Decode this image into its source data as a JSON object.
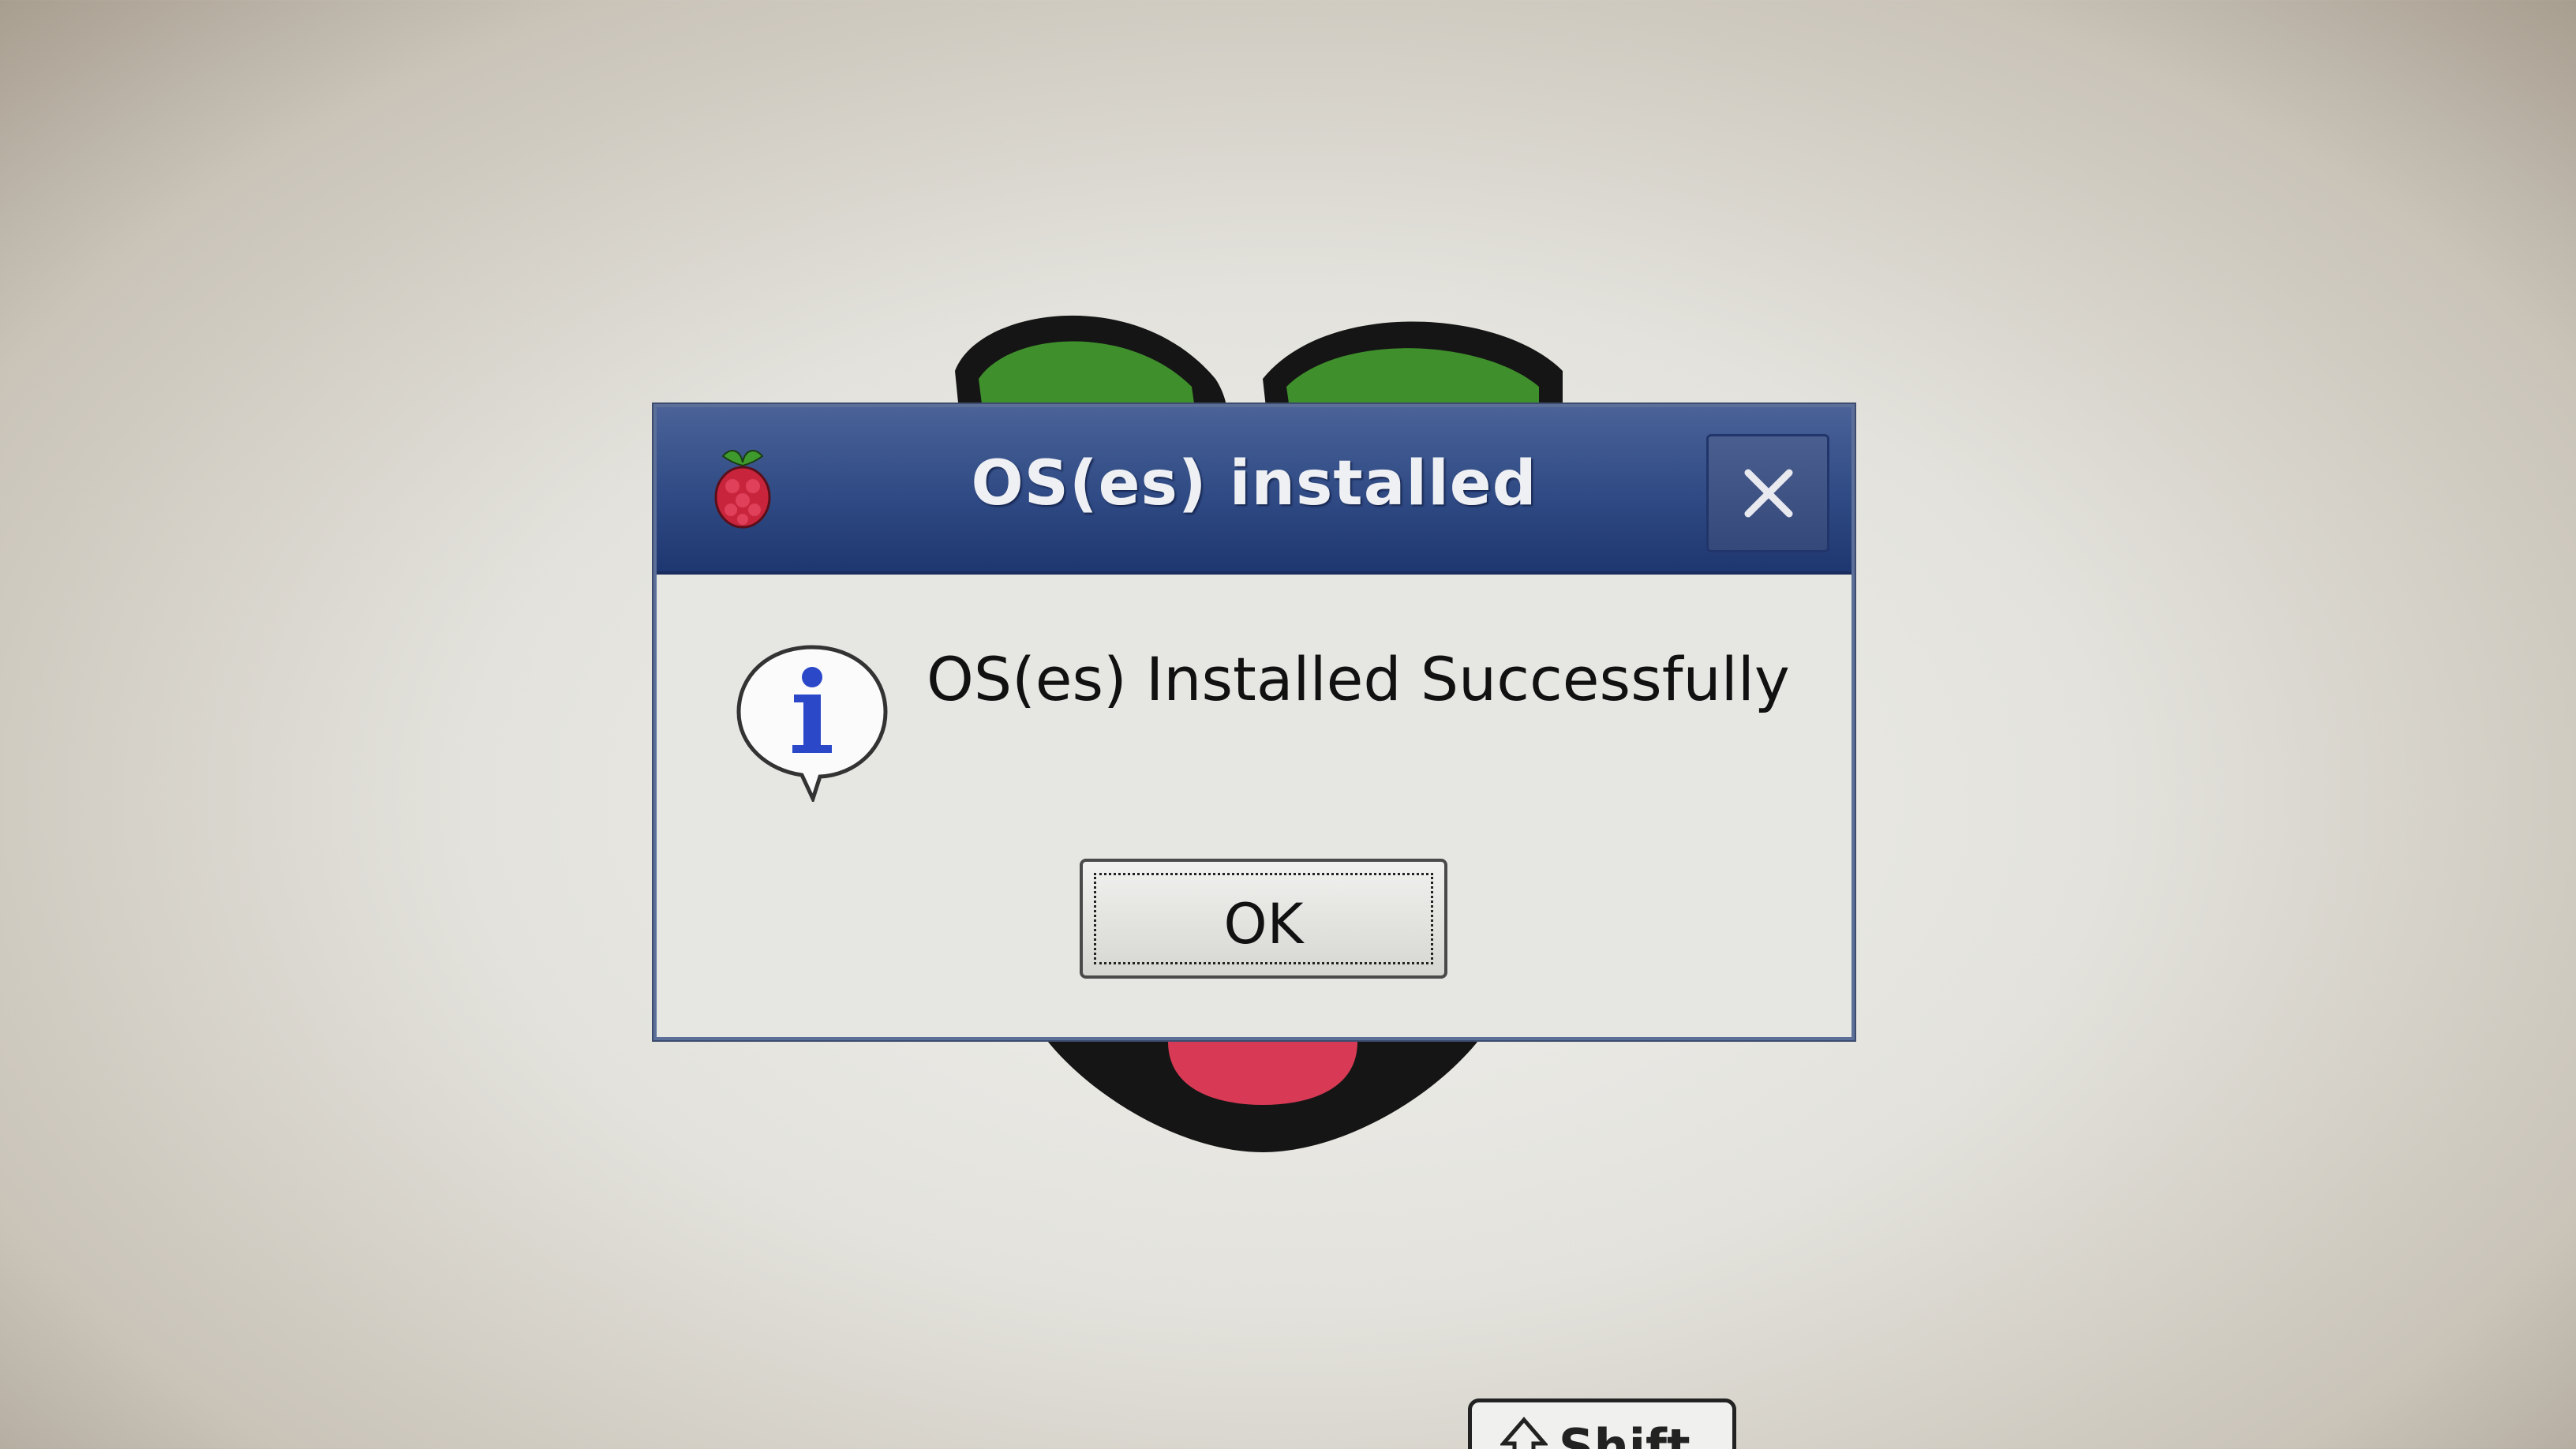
{
  "dialog": {
    "title": "OS(es) installed",
    "message": "OS(es) Installed Successfully",
    "ok_label": "OK",
    "close_icon": "close-icon",
    "app_icon": "raspberry-icon",
    "info_icon": "info-icon"
  },
  "background": {
    "logo": "raspberry-pi-logo",
    "hint_key_label": "Shift"
  },
  "colors": {
    "titlebar": "#2f4a84",
    "dialog_bg": "#e6e6e3",
    "leaf_green": "#3a8a2a",
    "berry_red": "#d83a55"
  }
}
